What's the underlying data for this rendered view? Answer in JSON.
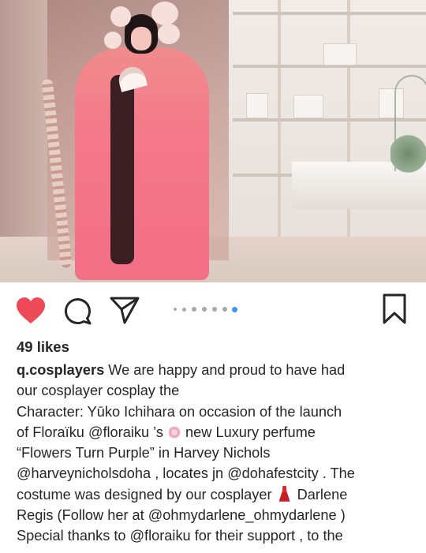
{
  "post": {
    "photo": {
      "description_icon": "cosplay-photo"
    },
    "actions": {
      "like_icon": "heart-filled-icon",
      "comment_icon": "comment-icon",
      "share_icon": "share-icon",
      "save_icon": "bookmark-icon",
      "liked": true,
      "like_color": "#ed4956",
      "carousel": {
        "total": 7,
        "active": 7
      }
    },
    "likes_text": "49 likes",
    "caption": {
      "username": "q.cosplayers",
      "line1_rest": " We are happy and proud to have had",
      "line2": "our cosplayer cosplay the",
      "line3": "Character: Yūko Ichihara on occasion of the launch",
      "line4_a": "of Floraïku ",
      "line4_mention": "@floraiku",
      "line4_b": " ’s ",
      "line4_c": " new Luxury perfume",
      "line5": "“Flowers Turn Purple” in Harvey Nichols",
      "line6_mention1": "@harveynicholsdoha",
      "line6_b": " , locates jn ",
      "line6_mention2": "@dohafestcity",
      "line6_c": " . The",
      "line7_a": "costume  was designed by our cosplayer ",
      "line7_b": " Darlene",
      "line8_a": "Regis (Follow her at ",
      "line8_mention": "@ohmydarlene_ohmydarlene",
      "line8_b": " )",
      "line9_a": "Special thanks to ",
      "line9_mention": "@floraiku",
      "line9_b": "  for their support , to the"
    }
  }
}
